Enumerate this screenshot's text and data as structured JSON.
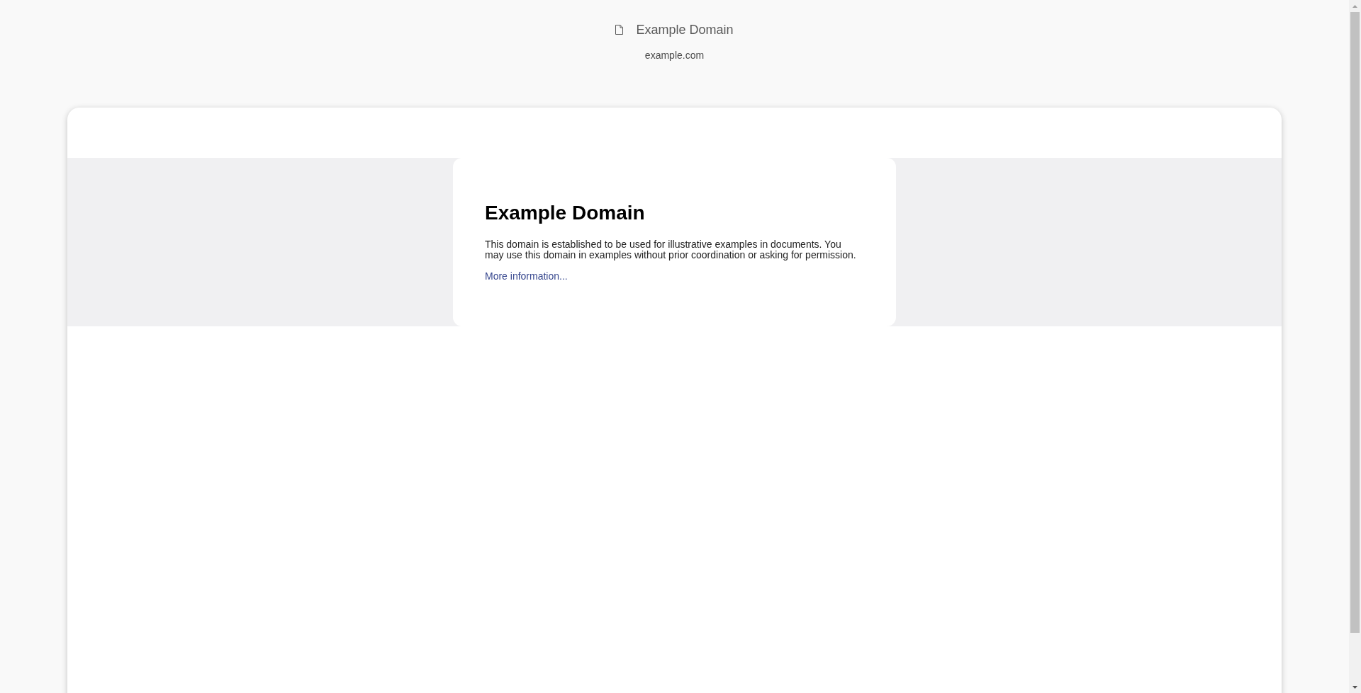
{
  "header": {
    "title": "Example Domain",
    "subtitle": "example.com"
  },
  "preview": {
    "heading": "Example Domain",
    "paragraph": "This domain is established to be used for illustrative examples in documents. You may use this domain in examples without prior coordination or asking for permission.",
    "link": "More information..."
  }
}
